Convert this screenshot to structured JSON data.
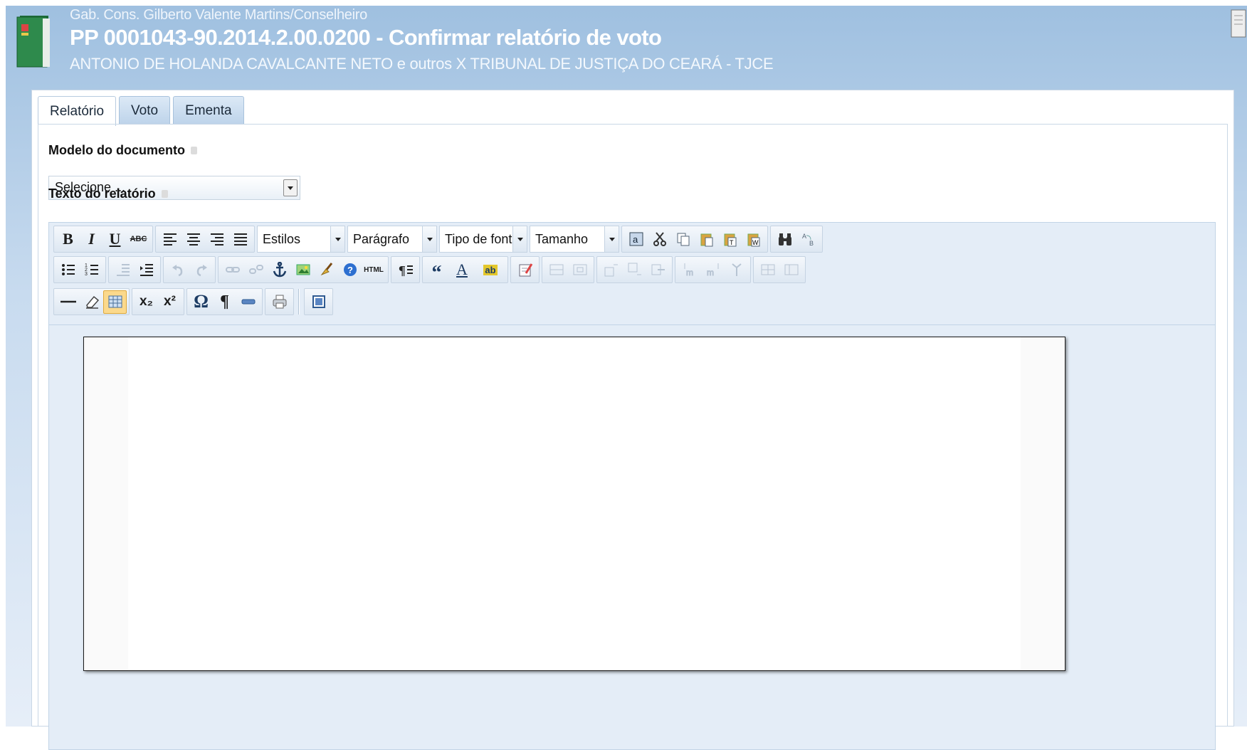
{
  "header": {
    "office": "Gab. Cons. Gilberto Valente Martins/Conselheiro",
    "title": "PP 0001043-90.2014.2.00.0200 - Confirmar relatório de voto",
    "parties": "ANTONIO DE HOLANDA CAVALCANTE NETO e outros X TRIBUNAL DE JUSTIÇA DO CEARÁ - TJCE"
  },
  "tabs": [
    {
      "label": "Relatório",
      "active": true
    },
    {
      "label": "Voto",
      "active": false
    },
    {
      "label": "Ementa",
      "active": false
    }
  ],
  "form": {
    "model_label": "Modelo do documento",
    "model_value": "Selecione ...",
    "text_label": "Texto do relatório"
  },
  "toolbar": {
    "styles": "Estilos",
    "format": "Parágrafo",
    "font": "Tipo de fonte",
    "size": "Tamanho",
    "icons": {
      "bold": "B",
      "italic": "I",
      "underline": "U",
      "strike": "ABC",
      "html": "HTML",
      "subscript": "x₂",
      "superscript": "x²",
      "omega": "Ω",
      "pilcrow": "¶",
      "quote": "“",
      "color": "A",
      "highlight": "ab"
    }
  },
  "colors": {
    "header_bg": "#9fc0e0",
    "editor_bg": "#e4edf7",
    "active_button": "#fbd98c"
  }
}
